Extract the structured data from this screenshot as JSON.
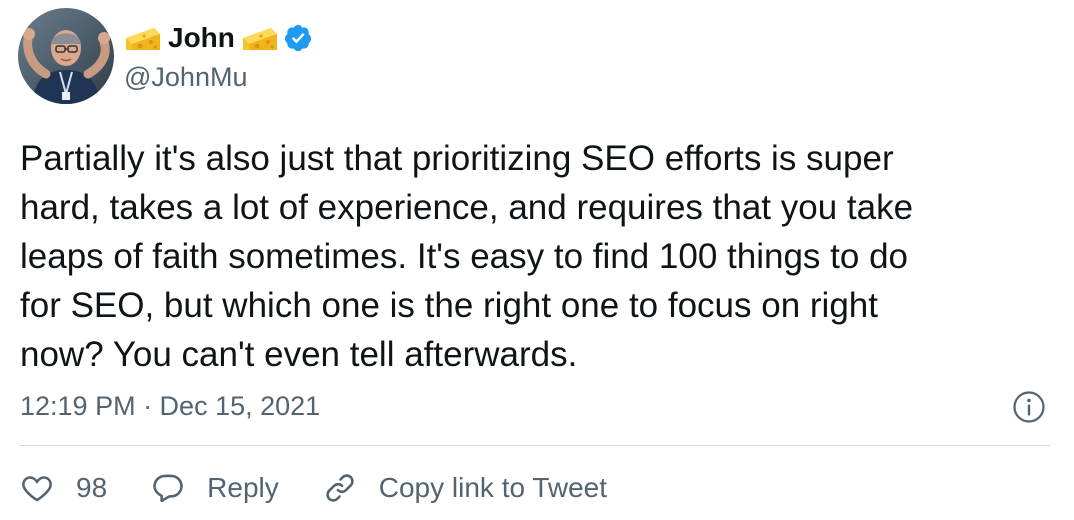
{
  "author": {
    "display_name": "John",
    "handle": "@JohnMu",
    "name_emoji": "cheese-wedge-icon",
    "verified": true,
    "verified_color": "#1d9bf0"
  },
  "tweet": {
    "text": "Partially it's also just that prioritizing SEO efforts is super\nhard, takes a lot of experience, and requires that you take\nleaps of faith sometimes. It's easy to find 100 things to do\nfor SEO, but which one is the right one to focus on right\nnow? You can't even tell afterwards.",
    "timestamp": "12:19 PM · Dec 15, 2021"
  },
  "actions": {
    "like_count": "98",
    "reply_label": "Reply",
    "copy_link_label": "Copy link to Tweet"
  },
  "colors": {
    "text_primary": "#0f1419",
    "text_secondary": "#536471",
    "divider": "#cfd9de"
  }
}
